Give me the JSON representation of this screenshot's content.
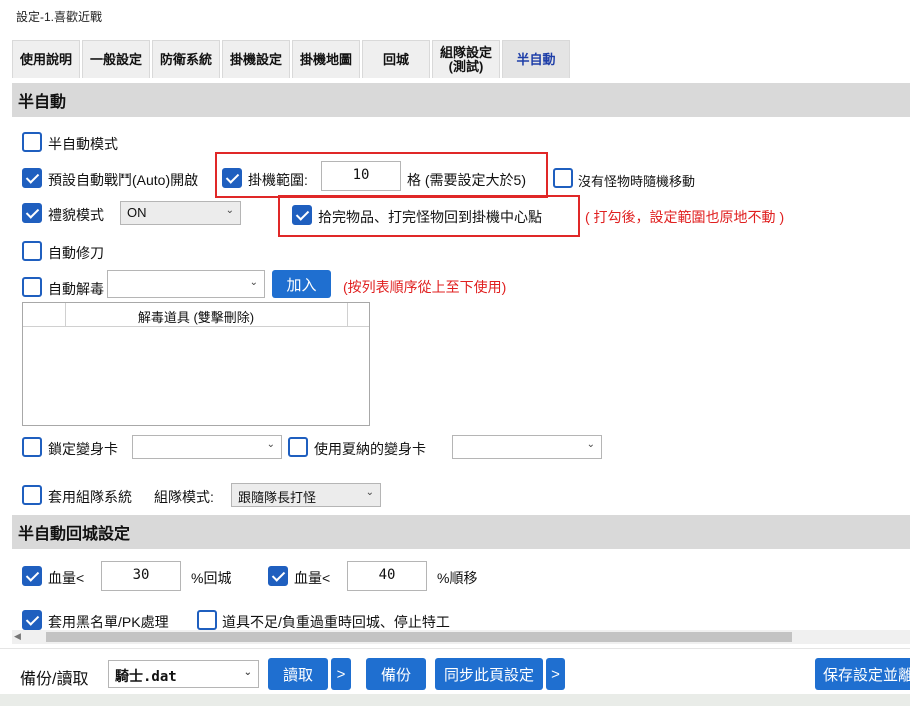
{
  "window": {
    "title": "設定-1.喜歡近戰"
  },
  "tabs": [
    {
      "label": "使用說明"
    },
    {
      "label": "一般設定"
    },
    {
      "label": "防衛系統"
    },
    {
      "label": "掛機設定"
    },
    {
      "label": "掛機地圖"
    },
    {
      "label": "回城"
    },
    {
      "label": "組隊設定\n(測試)"
    },
    {
      "label": "半自動"
    }
  ],
  "active_tab": "半自動",
  "semi_auto": {
    "header": "半自動",
    "mode_label": "半自動模式",
    "mode_checked": false,
    "auto_fight_label": "預設自動戰鬥(Auto)開啟",
    "auto_fight_checked": true,
    "range_label": "掛機範圍:",
    "range_checked": true,
    "range_value": "10",
    "range_unit": "格 (需要設定大於5)",
    "random_move_label": "沒有怪物時隨機移動",
    "random_move_checked": false,
    "polite_label": "禮貌模式",
    "polite_checked": true,
    "polite_value": "ON",
    "return_center_label": "拾完物品、打完怪物回到掛機中心點",
    "return_center_checked": true,
    "return_center_note": "( 打勾後，設定範圍也原地不動 )",
    "auto_blade_label": "自動修刀",
    "auto_blade_checked": false,
    "auto_detox_label": "自動解毒",
    "auto_detox_checked": false,
    "add_button": "加入",
    "order_note": "(按列表順序從上至下使用)",
    "detox_list_header": "解毒道具 (雙擊刪除)",
    "lock_card_label": "鎖定變身卡",
    "lock_card_checked": false,
    "summer_card_label": "使用夏納的變身卡",
    "summer_card_checked": false,
    "party_label": "套用組隊系統",
    "party_checked": false,
    "party_mode_label": "組隊模式:",
    "party_mode_value": "跟隨隊長打怪"
  },
  "return_town": {
    "header": "半自動回城設定",
    "hp1_label": "血量<",
    "hp1_checked": true,
    "hp1_value": "30",
    "hp1_suffix": "%回城",
    "hp2_label": "血量<",
    "hp2_checked": true,
    "hp2_value": "40",
    "hp2_suffix": "%順移",
    "blacklist_label": "套用黑名單/PK處理",
    "blacklist_checked": true,
    "shortage_label": "道具不足/負重過重時回城、停止特工",
    "shortage_checked": false
  },
  "bottom": {
    "backup_label": "備份/讀取",
    "file_value": "騎士.dat",
    "read_button": "讀取",
    "more_button": ">",
    "backup_button": "備份",
    "sync_button": "同步此頁設定",
    "sync_more_button": ">",
    "save_button": "保存設定並離"
  },
  "colors": {
    "accent": "#1f6fd0",
    "checkbox": "#1f5fbf",
    "highlight_box": "#e02828",
    "note_red": "#e02020",
    "active_tab_text": "#1e3ea8"
  }
}
